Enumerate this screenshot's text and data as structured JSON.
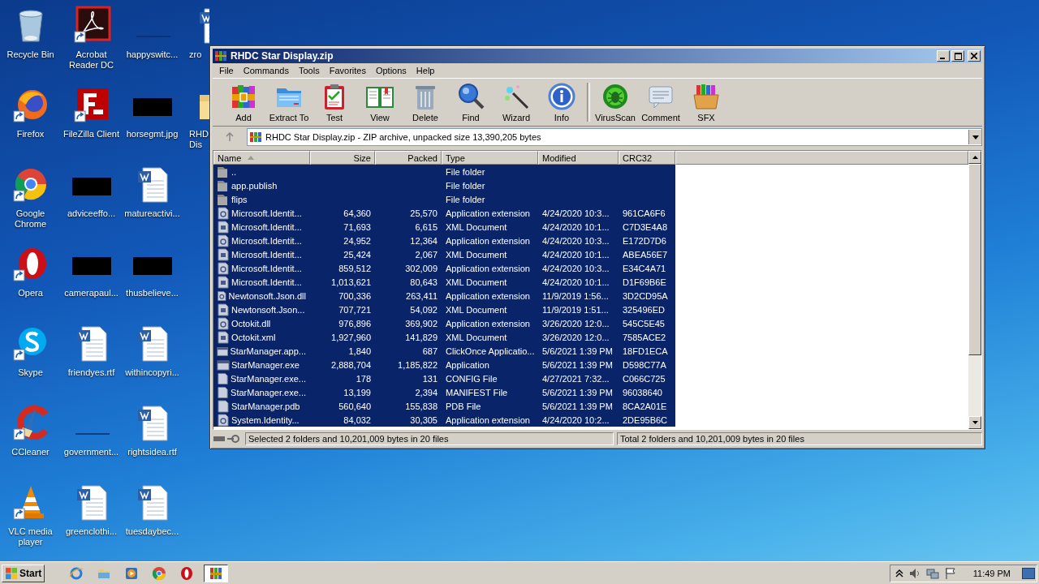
{
  "desktop_columns": [
    [
      {
        "label": "Recycle Bin",
        "kind": "recycle",
        "shortcut": false
      },
      {
        "label": "Firefox",
        "kind": "firefox",
        "shortcut": true
      },
      {
        "label": "Google Chrome",
        "kind": "chrome",
        "shortcut": true
      },
      {
        "label": "Opera",
        "kind": "opera",
        "shortcut": true
      },
      {
        "label": "Skype",
        "kind": "skype",
        "shortcut": true
      },
      {
        "label": "CCleaner",
        "kind": "ccleaner",
        "shortcut": true
      },
      {
        "label": "VLC media player",
        "kind": "vlc",
        "shortcut": true
      }
    ],
    [
      {
        "label": "Acrobat Reader DC",
        "kind": "acrobat",
        "shortcut": true
      },
      {
        "label": "FileZilla Client",
        "kind": "filezilla",
        "shortcut": true
      },
      {
        "label": "adviceeffo...",
        "kind": "redacted",
        "shortcut": false
      },
      {
        "label": "camerapaul...",
        "kind": "redacted",
        "shortcut": false
      },
      {
        "label": "friendyes.rtf",
        "kind": "word",
        "shortcut": false
      },
      {
        "label": "government...",
        "kind": "blank",
        "shortcut": false
      },
      {
        "label": "greenclothi...",
        "kind": "word",
        "shortcut": false
      }
    ],
    [
      {
        "label": "happyswitc...",
        "kind": "blank",
        "shortcut": false
      },
      {
        "label": "horsegmt.jpg",
        "kind": "redacted",
        "shortcut": false
      },
      {
        "label": "matureactivi...",
        "kind": "word",
        "shortcut": false
      },
      {
        "label": "thusbelieve...",
        "kind": "redacted",
        "shortcut": false
      },
      {
        "label": "withincopyri...",
        "kind": "word",
        "shortcut": false
      },
      {
        "label": "rightsidea.rtf",
        "kind": "word",
        "shortcut": false
      },
      {
        "label": "tuesdaybec...",
        "kind": "word",
        "shortcut": false
      }
    ],
    [
      {
        "label": "zro",
        "kind": "word",
        "shortcut": false
      },
      {
        "label": "RHD Dis",
        "kind": "folder",
        "shortcut": false
      }
    ]
  ],
  "window": {
    "title": "RHDC Star Display.zip",
    "menu": [
      "File",
      "Commands",
      "Tools",
      "Favorites",
      "Options",
      "Help"
    ],
    "toolbar": [
      [
        {
          "label": "Add",
          "kind": "add"
        },
        {
          "label": "Extract To",
          "kind": "extract"
        },
        {
          "label": "Test",
          "kind": "test"
        },
        {
          "label": "View",
          "kind": "view"
        },
        {
          "label": "Delete",
          "kind": "delete"
        },
        {
          "label": "Find",
          "kind": "find"
        },
        {
          "label": "Wizard",
          "kind": "wizard"
        },
        {
          "label": "Info",
          "kind": "info"
        }
      ],
      [
        {
          "label": "VirusScan",
          "kind": "virus"
        },
        {
          "label": "Comment",
          "kind": "comment"
        },
        {
          "label": "SFX",
          "kind": "sfx"
        }
      ]
    ],
    "address": "RHDC Star Display.zip - ZIP archive, unpacked size 13,390,205 bytes",
    "columns": [
      "Name",
      "Size",
      "Packed",
      "Type",
      "Modified",
      "CRC32"
    ],
    "rows": [
      {
        "kind": "folder",
        "name": "..",
        "type": "File folder",
        "selected": true
      },
      {
        "kind": "folder",
        "name": "app.publish",
        "type": "File folder",
        "selected": true
      },
      {
        "kind": "folder",
        "name": "flips",
        "type": "File folder",
        "selected": true
      },
      {
        "kind": "dll",
        "name": "Microsoft.Identit...",
        "size": "64,360",
        "packed": "25,570",
        "type": "Application extension",
        "modified": "4/24/2020 10:3...",
        "crc": "961CA6F6",
        "selected": true
      },
      {
        "kind": "xml",
        "name": "Microsoft.Identit...",
        "size": "71,693",
        "packed": "6,615",
        "type": "XML Document",
        "modified": "4/24/2020 10:1...",
        "crc": "C7D3E4A8",
        "selected": true
      },
      {
        "kind": "dll",
        "name": "Microsoft.Identit...",
        "size": "24,952",
        "packed": "12,364",
        "type": "Application extension",
        "modified": "4/24/2020 10:3...",
        "crc": "E172D7D6",
        "selected": true
      },
      {
        "kind": "xml",
        "name": "Microsoft.Identit...",
        "size": "25,424",
        "packed": "2,067",
        "type": "XML Document",
        "modified": "4/24/2020 10:1...",
        "crc": "ABEA56E7",
        "selected": true
      },
      {
        "kind": "dll",
        "name": "Microsoft.Identit...",
        "size": "859,512",
        "packed": "302,009",
        "type": "Application extension",
        "modified": "4/24/2020 10:3...",
        "crc": "E34C4A71",
        "selected": true
      },
      {
        "kind": "xml",
        "name": "Microsoft.Identit...",
        "size": "1,013,621",
        "packed": "80,643",
        "type": "XML Document",
        "modified": "4/24/2020 10:1...",
        "crc": "D1F69B6E",
        "selected": true
      },
      {
        "kind": "dll",
        "name": "Newtonsoft.Json.dll",
        "size": "700,336",
        "packed": "263,411",
        "type": "Application extension",
        "modified": "11/9/2019 1:56...",
        "crc": "3D2CD95A",
        "selected": true
      },
      {
        "kind": "xml",
        "name": "Newtonsoft.Json...",
        "size": "707,721",
        "packed": "54,092",
        "type": "XML Document",
        "modified": "11/9/2019 1:51...",
        "crc": "325496ED",
        "selected": true
      },
      {
        "kind": "dll",
        "name": "Octokit.dll",
        "size": "976,896",
        "packed": "369,902",
        "type": "Application extension",
        "modified": "3/26/2020 12:0...",
        "crc": "545C5E45",
        "selected": true
      },
      {
        "kind": "xml",
        "name": "Octokit.xml",
        "size": "1,927,960",
        "packed": "141,829",
        "type": "XML Document",
        "modified": "3/26/2020 12:0...",
        "crc": "7585ACE2",
        "selected": true
      },
      {
        "kind": "app",
        "name": "StarManager.app...",
        "size": "1,840",
        "packed": "687",
        "type": "ClickOnce Applicatio...",
        "modified": "5/6/2021 1:39 PM",
        "crc": "18FD1ECA",
        "selected": true
      },
      {
        "kind": "exe",
        "name": "StarManager.exe",
        "size": "2,888,704",
        "packed": "1,185,822",
        "type": "Application",
        "modified": "5/6/2021 1:39 PM",
        "crc": "D598C77A",
        "selected": true
      },
      {
        "kind": "file",
        "name": "StarManager.exe...",
        "size": "178",
        "packed": "131",
        "type": "CONFIG File",
        "modified": "4/27/2021 7:32...",
        "crc": "C066C725",
        "selected": true
      },
      {
        "kind": "file",
        "name": "StarManager.exe...",
        "size": "13,199",
        "packed": "2,394",
        "type": "MANIFEST File",
        "modified": "5/6/2021 1:39 PM",
        "crc": "96038640",
        "selected": true
      },
      {
        "kind": "file",
        "name": "StarManager.pdb",
        "size": "560,640",
        "packed": "155,838",
        "type": "PDB File",
        "modified": "5/6/2021 1:39 PM",
        "crc": "8CA2A01E",
        "selected": true
      },
      {
        "kind": "dll",
        "name": "System.Identity...",
        "size": "84,032",
        "packed": "30,305",
        "type": "Application extension",
        "modified": "4/24/2020 10:2...",
        "crc": "2DE95B6C",
        "selected": true
      }
    ],
    "status_left": "Selected 2 folders and 10,201,009 bytes in 20 files",
    "status_right": "Total 2 folders and 10,201,009 bytes in 20 files"
  },
  "taskbar": {
    "start": "Start",
    "items": [
      {
        "kind": "ie",
        "selected": false
      },
      {
        "kind": "explorer",
        "selected": false
      },
      {
        "kind": "media",
        "selected": false
      },
      {
        "kind": "chrome",
        "selected": false
      },
      {
        "kind": "opera",
        "selected": false
      },
      {
        "kind": "winrar",
        "selected": true
      }
    ],
    "clock": "11:49 PM"
  }
}
